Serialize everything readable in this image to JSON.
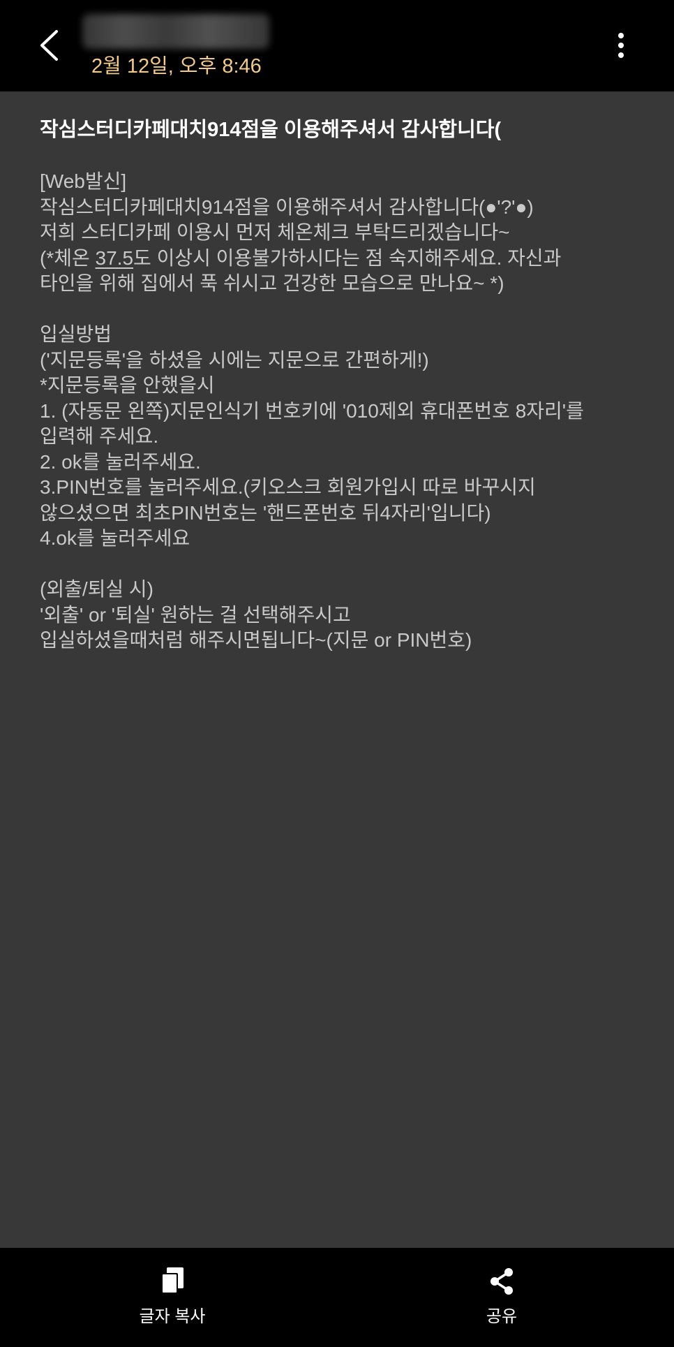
{
  "header": {
    "back_icon": "back-arrow-icon",
    "timestamp": "2월 12일, 오후 8:46",
    "more_icon": "more-vertical-icon"
  },
  "message": {
    "title": "작심스터디카페대치914점을 이용해주셔서 감사합니다(",
    "lines": [
      "[Web발신]",
      "작심스터디카페대치914점을 이용해주셔서 감사합니다(●'?'●)",
      "저희 스터디카페 이용시 먼저 체온체크 부탁드리겠습니다~",
      "",
      "타인을 위해 집에서 푹 쉬시고 건강한 모습으로 만나요~ *)",
      "",
      "입실방법",
      "('지문등록'을 하셨을 시에는 지문으로 간편하게!)",
      "*지문등록을 안했을시",
      "1. (자동문 왼쪽)지문인식기  번호키에 '010제외 휴대폰번호 8자리'를",
      "입력해 주세요.",
      "2. ok를 눌러주세요.",
      "3.PIN번호를 눌러주세요.(키오스크 회원가입시 따로 바꾸시지",
      "않으셨으면 최초PIN번호는 '핸드폰번호 뒤4자리'입니다)",
      "4.ok를 눌러주세요",
      "",
      "(외출/퇴실 시)",
      "'외출' or '퇴실' 원하는 걸 선택해주시고",
      "입실하셨을때처럼 해주시면됩니다~(지문 or PIN번호)"
    ],
    "temp_line_prefix": "(*체온 ",
    "temp_value": "37.5",
    "temp_line_suffix": "도 이상시 이용불가하시다는 점 숙지해주세요. 자신과"
  },
  "bottom_bar": {
    "copy_label": "글자 복사",
    "copy_icon": "copy-icon",
    "share_label": "공유",
    "share_icon": "share-icon"
  },
  "colors": {
    "timestamp": "#f3c98e",
    "background": "#383838",
    "bar": "#000000",
    "body_text": "#c9c9c9"
  }
}
